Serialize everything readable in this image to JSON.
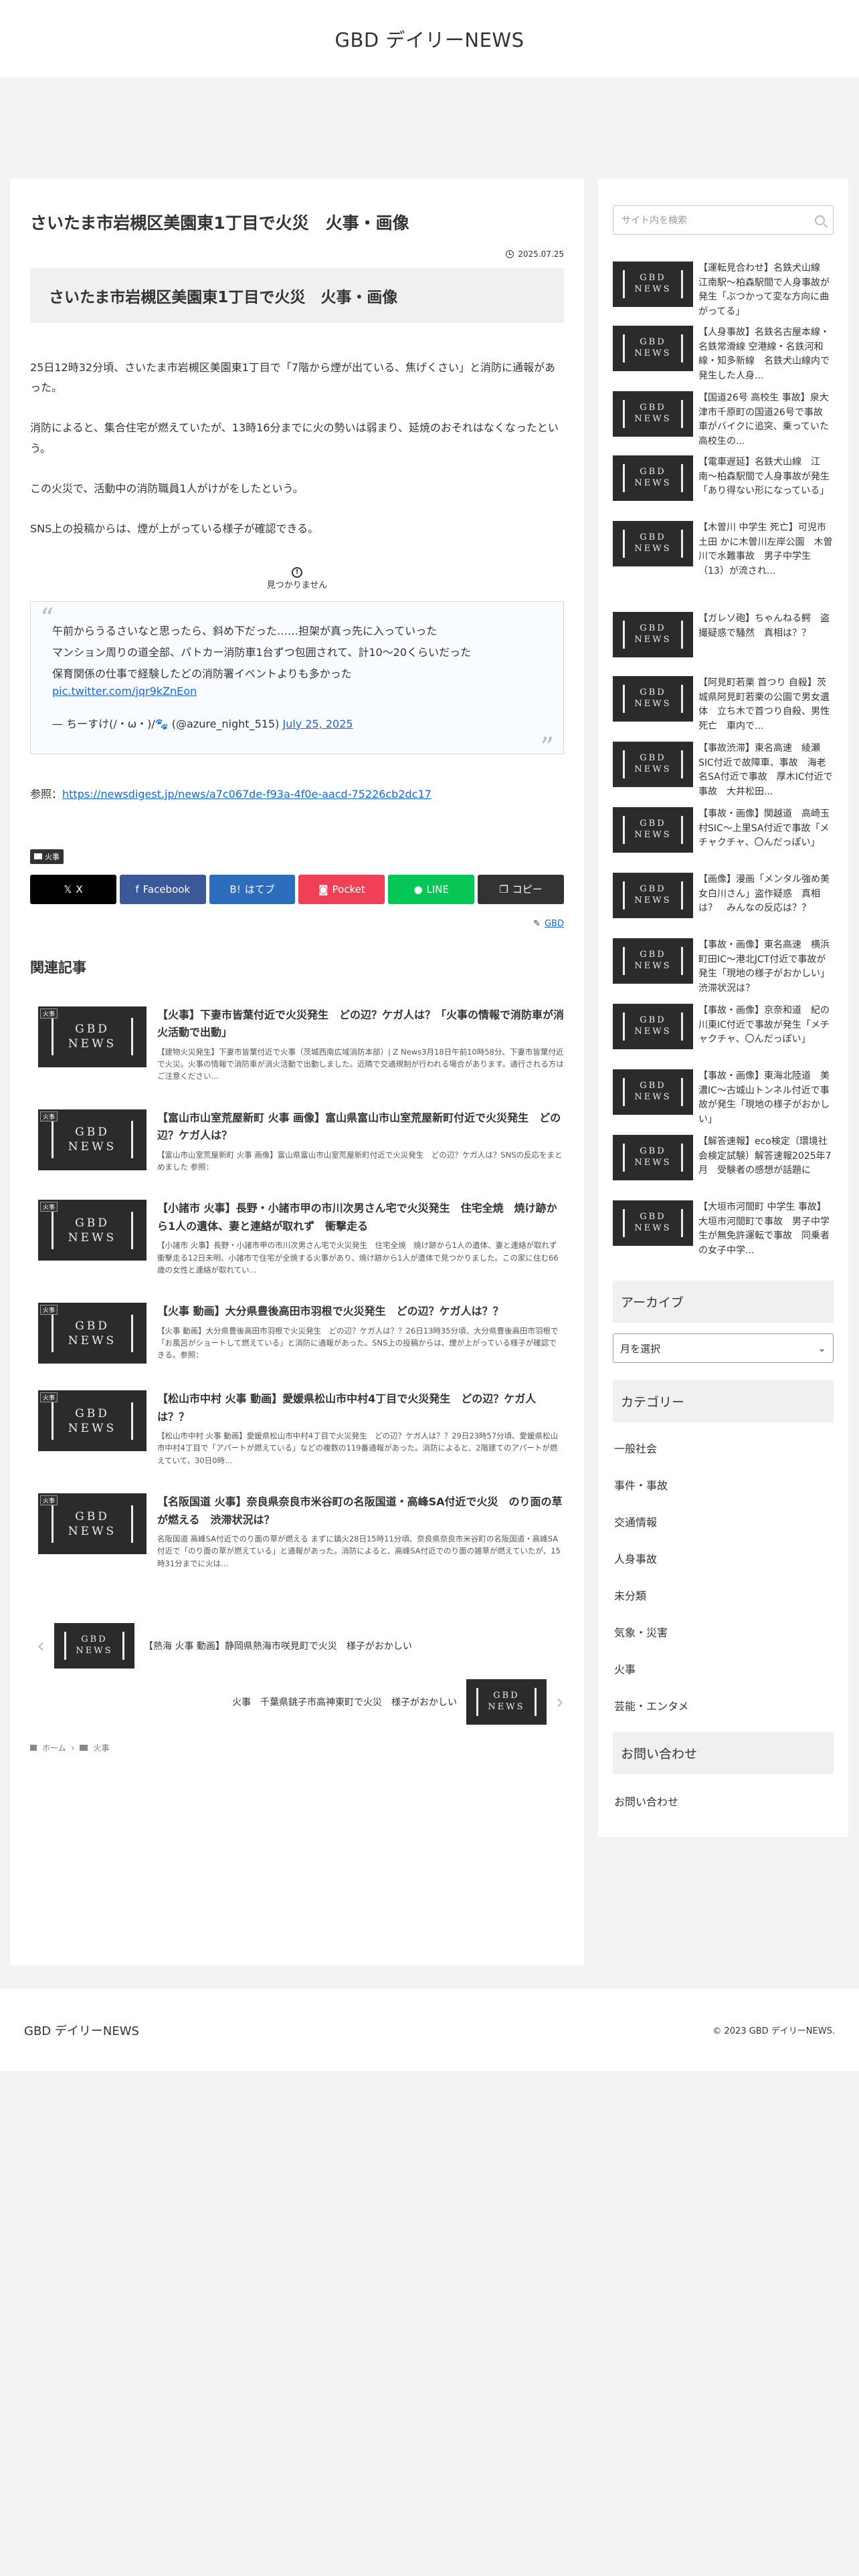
{
  "site": {
    "title": "GBD デイリーNEWS"
  },
  "article": {
    "title": "さいたま市岩槻区美園東1丁目で火災　火事・画像",
    "date": "2025.07.25",
    "heading": "さいたま市岩槻区美園東1丁目で火災　火事・画像",
    "paragraphs": [
      "25日12時32分頃、さいたま市岩槻区美園東1丁目で「7階から煙が出ている、焦げくさい」と消防に通報があった。",
      "消防によると、集合住宅が燃えていたが、13時16分までに火の勢いは弱まり、延焼のおそれはなくなったという。",
      "この火災で、活動中の消防職員1人がけがをしたという。",
      "SNS上の投稿からは、煙が上がっている様子が確認できる。"
    ],
    "not_found_label": "見つかりません",
    "tweet": {
      "text": "午前からうるさいなと思ったら、斜め下だった……担架が真っ先に入っていった\nマンション周りの道全部、パトカー消防車1台ずつ包囲されて、計10〜20くらいだった\n保育関係の仕事で経験したどの消防署イベントよりも多かった",
      "link": "pic.twitter.com/jqr9kZnEon",
      "author": "— ちーすけ(/・ω・)/🐾 (@azure_night_515)",
      "date_link": "July 25, 2025"
    },
    "ref_label": "参照：",
    "ref_url": "https://newsdigest.jp/news/a7c067de-f93a-4f0e-aacd-75226cb2dc17",
    "category": "火事",
    "share": [
      {
        "label": "X",
        "color": "#000000"
      },
      {
        "label": "Facebook",
        "color": "#3b5998"
      },
      {
        "label": "はてブ",
        "color": "#2c6ebd"
      },
      {
        "label": "Pocket",
        "color": "#ef4056"
      },
      {
        "label": "LINE",
        "color": "#06c755"
      },
      {
        "label": "コピー",
        "color": "#333333"
      }
    ],
    "amp_label": "GBD"
  },
  "related": {
    "heading": "関連記事",
    "thumb_text": "GBD NEWS",
    "thumb_tag": "火事",
    "items": [
      {
        "title": "【火事】下妻市皆葉付近で火災発生　どの辺？ケガ人は？「火事の情報で消防車が消火活動で出動」",
        "snippet": "【建物火災発生】下妻市皆葉付近で火事（茨城西南広域消防本部）| Z News3月18日午前10時58分、下妻市皆葉付近で火災。火事の情報で消防車が消火活動で出動しました。近隣で交通規制が行われる場合があります。通行される方はご注意ください..."
      },
      {
        "title": "【富山市山室荒屋新町 火事 画像】富山県富山市山室荒屋新町付近で火災発生　どの辺？ケガ人は？",
        "snippet": "【富山市山室荒屋新町 火事 画像】富山県富山市山室荒屋新町付近で火災発生　どの辺？ケガ人は？SNSの反応をまとめました 参照："
      },
      {
        "title": "【小諸市 火事】長野・小諸市甲の市川次男さん宅で火災発生　住宅全焼　焼け跡から1人の遺体、妻と連絡が取れず　衝撃走る",
        "snippet": "【小諸市 火事】長野・小諸市甲の市川次男さん宅で火災発生　住宅全焼　焼け跡から1人の遺体、妻と連絡が取れず　衝撃走る12日未明、小諸市で住宅が全焼する火事があり、焼け跡から1人が遺体で見つかりました。この家に住む66歳の女性と連絡が取れてい..."
      },
      {
        "title": "【火事 動画】大分県豊後高田市羽根で火災発生　どの辺？ケガ人は？？",
        "snippet": "【火事 動画】大分県豊後高田市羽根で火災発生　どの辺？ケガ人は？？26日13時35分頃、大分県豊後高田市羽根で「お風呂がショートして燃えている」と消防に通報があった。SNS上の投稿からは、煙が上がっている様子が確認できる。参照："
      },
      {
        "title": "【松山市中村 火事 動画】愛媛県松山市中村4丁目で火災発生　どの辺？ケガ人は？？",
        "snippet": "【松山市中村 火事 動画】愛媛県松山市中村4丁目で火災発生　どの辺？ケガ人は？？29日23時57分頃、愛媛県松山市中村4丁目で「アパートが燃えている」などの複数の119番通報があった。消防によると、2階建てのアパートが燃えていて、30日0時..."
      },
      {
        "title": "【名阪国道 火事】奈良県奈良市米谷町の名阪国道・高峰SA付近で火災　のり面の草が燃える　渋滞状況は？",
        "snippet": "名阪国道 高峰SA付近でのり面の草が燃える まずに鎮火28日15時11分頃、奈良県奈良市米谷町の名阪国道・高峰SA付近で「のり面の草が燃えている」と通報があった。消防によると、高峰SA付近でのり面の雑草が燃えていたが、15時31分までに火は..."
      }
    ]
  },
  "pager": {
    "prev": "【熱海 火事 動画】静岡県熱海市咲見町で火災　様子がおかしい",
    "next": "火事　千葉県銚子市高神東町で火災　様子がおかしい"
  },
  "breadcrumb": {
    "home": "ホーム",
    "category": "火事"
  },
  "sidebar": {
    "search_placeholder": "サイト内を検索",
    "recent": [
      "【運転見合わせ】名鉄犬山線　江南駅〜柏森駅間で人身事故が発生「ぶつかって変な方向に曲がってる」",
      "【人身事故】名鉄名古屋本線・名鉄常滑線 空港線・名鉄河和線・知多新線　名鉄犬山線内で発生した人身...",
      "【国道26号 高校生 事故】泉大津市千原町の国道26号で事故　車がバイクに追突、乗っていた高校生の...",
      "【電車遅延】名鉄犬山線　江南〜柏森駅間で人身事故が発生「あり得ない形になっている」",
      "【木曽川 中学生 死亡】可児市土田 かに木曽川左岸公園　木曽川で水難事故　男子中学生（13）が流され...",
      "【ガレソ砲】ちゃんねる鰐　盗撮疑惑で騒然　真相は？？",
      "【阿見町若栗 首つり 自殺】茨城県阿見町若栗の公園で男女遺体　立ち木で首つり自殺、男性死亡　車内で...",
      "【事故渋滞】東名高速　綾瀬SIC付近で故障車、事故　海老名SA付近で事故　厚木IC付近で事故　大井松田...",
      "【事故・画像】関越道　高崎玉村SIC〜上里SA付近で事故「メチャクチャ、〇んだっぽい」",
      "【画像】漫画「メンタル強め美女白川さん」盗作疑惑　真相は？　みんなの反応は？？",
      "【事故・画像】東名高速　横浜町田IC〜港北JCT付近で事故が発生「現地の様子がおかしい」渋滞状況は？",
      "【事故・画像】京奈和道　紀の川東IC付近で事故が発生「メチャクチャ、〇んだっぽい」",
      "【事故・画像】東海北陸道　美濃IC〜古城山トンネル付近で事故が発生「現地の様子がおかしい」",
      "【解答速報】eco検定（環境社会検定試験）解答速報2025年7月　受験者の感想が話題に",
      "【大垣市河間町 中学生 事故】大垣市河間町で事故　男子中学生が無免許運転で事故　同乗者の女子中学..."
    ],
    "archive_title": "アーカイブ",
    "archive_select": "月を選択",
    "category_title": "カテゴリー",
    "categories": [
      "一般社会",
      "事件・事故",
      "交通情報",
      "人身事故",
      "未分類",
      "気象・災害",
      "火事",
      "芸能・エンタメ"
    ],
    "contact_title": "お問い合わせ",
    "contact_link": "お問い合わせ"
  },
  "footer": {
    "logo": "GBD デイリーNEWS",
    "copyright": "© 2023 GBD デイリーNEWS."
  }
}
